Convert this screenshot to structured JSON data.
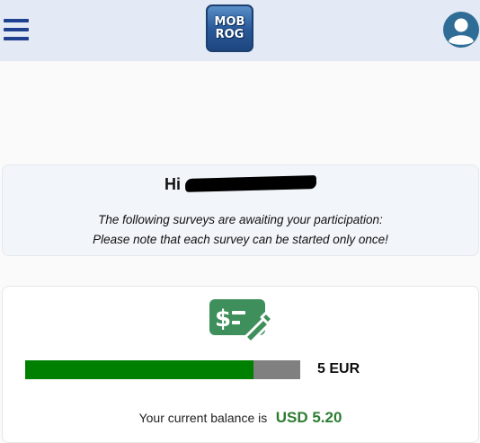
{
  "header": {
    "logo_line1": "MOB",
    "logo_line2": "ROG"
  },
  "greeting": {
    "hi": "Hi",
    "line1": "The following surveys are awaiting your participation:",
    "line2": "Please note that each survey can be started only once!"
  },
  "balance": {
    "progress_fraction": 0.83,
    "target": "5 EUR",
    "label": "Your current balance is",
    "value": "USD 5.20"
  },
  "colors": {
    "header_bg": "#e3eaf5",
    "progress_fill": "#008000",
    "progress_track": "#808080",
    "balance_value": "#2e7d32",
    "icon_green": "#3e8f5b"
  }
}
